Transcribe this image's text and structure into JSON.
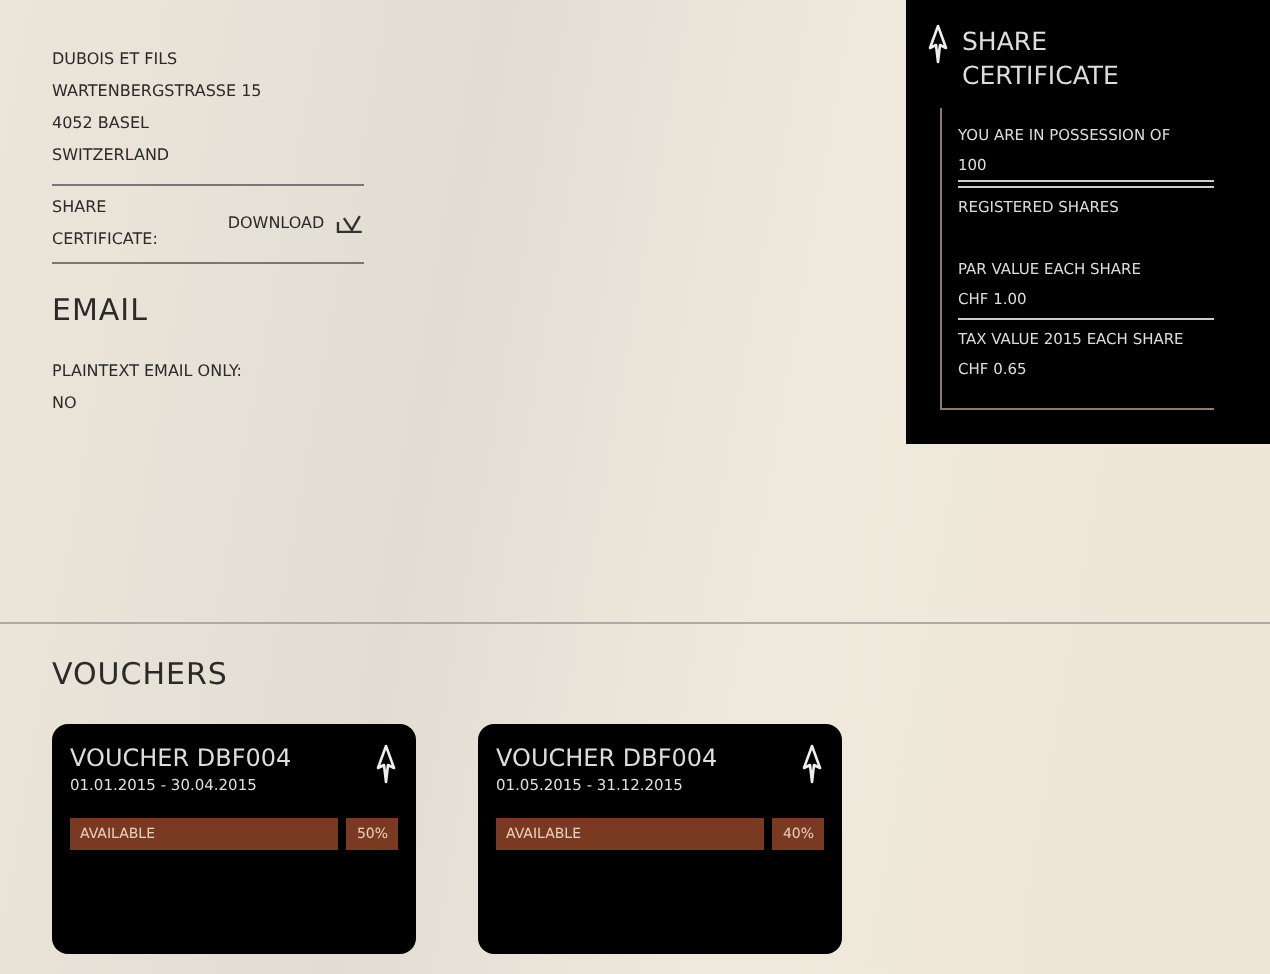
{
  "address": [
    "DUBOIS ET FILS",
    "WARTENBERGSTRASSE 15",
    "4052 BASEL",
    "SWITZERLAND"
  ],
  "download": {
    "label": "SHARE CERTIFICATE:",
    "link": "DOWNLOAD"
  },
  "email": {
    "heading": "EMAIL",
    "label": "PLAINTEXT EMAIL ONLY:",
    "value": "NO"
  },
  "certificate": {
    "title": "SHARE CERTIFICATE",
    "rows": [
      {
        "label": "YOU ARE IN POSSESSION OF",
        "value": "100"
      },
      {
        "label": "REGISTERED SHARES"
      },
      {
        "label": "PAR VALUE EACH SHARE",
        "value": "CHF 1.00"
      },
      {
        "label": "TAX VALUE 2015 EACH SHARE",
        "value": "CHF 0.65"
      }
    ]
  },
  "vouchers": {
    "heading": "VOUCHERS",
    "items": [
      {
        "title": "VOUCHER DBF004",
        "dates": "01.01.2015 - 30.04.2015",
        "status": "AVAILABLE",
        "percent": "50%"
      },
      {
        "title": "VOUCHER DBF004",
        "dates": "01.05.2015 - 31.12.2015",
        "status": "AVAILABLE",
        "percent": "40%"
      }
    ]
  }
}
